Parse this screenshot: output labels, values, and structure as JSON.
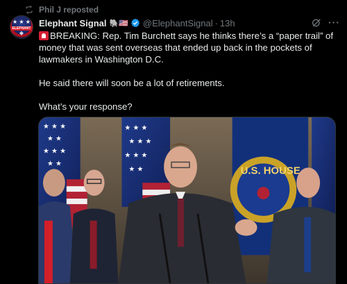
{
  "repost": {
    "label": "Phil J reposted",
    "icon": "repost-icon"
  },
  "author": {
    "name": "Elephant Signal",
    "emoji": "🐘🇺🇸",
    "handle": "@ElephantSignal",
    "separator": "·",
    "time": "13h",
    "avatar_text": "ELEPHANT",
    "verified": true
  },
  "tweet": {
    "line1": "BREAKING: Rep. Tim Burchett says he thinks there’s a “paper trail” of money that was sent overseas that ended up back in the pockets of lawmakers in Washington D.C.",
    "line2": "He said there will soon be a lot of retirements.",
    "line3": "What’s your response?"
  },
  "media": {
    "sign_text": "U.S. HOUSE"
  },
  "colors": {
    "background": "#000000",
    "text": "#e7e9ea",
    "muted": "#71767b",
    "verified": "#1d9bf0"
  }
}
